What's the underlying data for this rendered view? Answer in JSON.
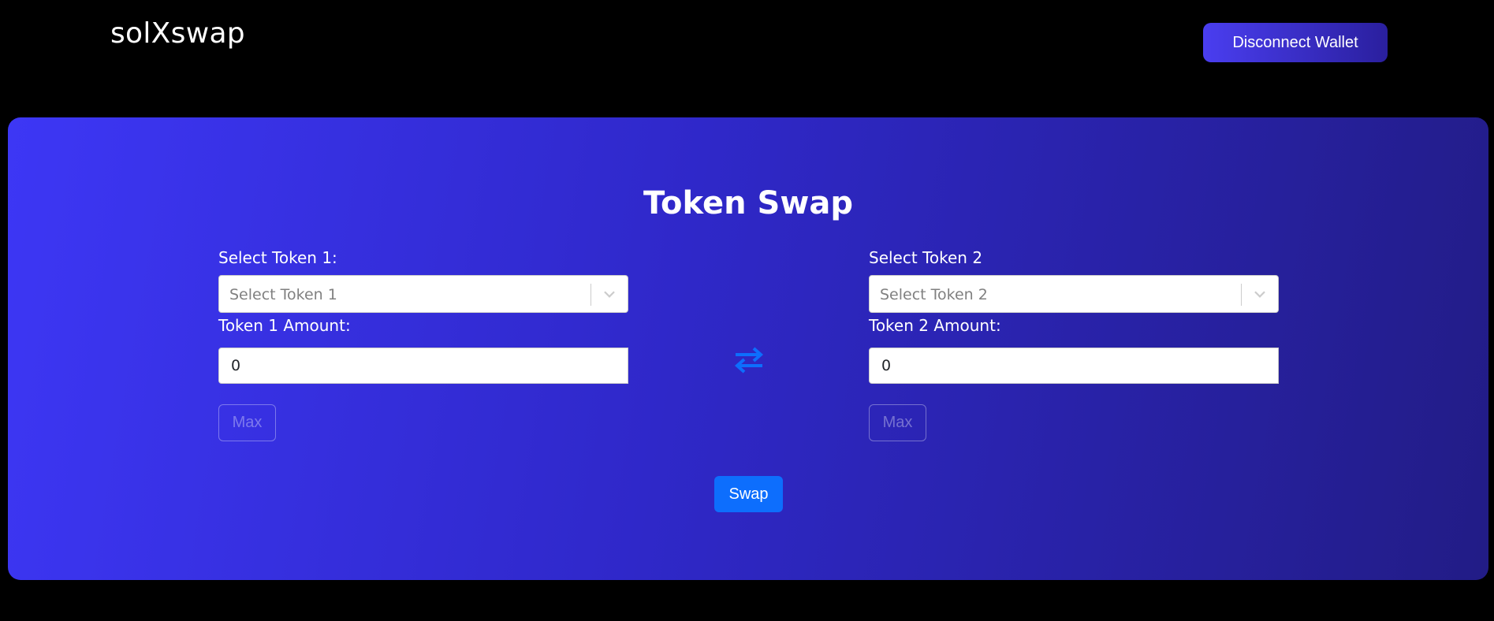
{
  "header": {
    "brand": "solXswap",
    "disconnect_label": "Disconnect Wallet"
  },
  "main": {
    "title": "Token Swap",
    "token1": {
      "select_label": "Select Token 1:",
      "select_placeholder": "Select Token 1",
      "amount_label": "Token 1 Amount:",
      "amount_value": "0",
      "max_label": "Max"
    },
    "token2": {
      "select_label": "Select Token 2",
      "select_placeholder": "Select Token 2",
      "amount_label": "Token 2 Amount:",
      "amount_value": "0",
      "max_label": "Max"
    },
    "swap_label": "Swap"
  },
  "icons": {
    "swap_direction": "arrows-left-right-icon",
    "dropdown": "chevron-down-icon"
  },
  "colors": {
    "background": "#000000",
    "panel_gradient_start": "#3d37f5",
    "panel_gradient_end": "#221c86",
    "swap_button": "#0d6efd",
    "swap_icon": "#0d6efd"
  }
}
